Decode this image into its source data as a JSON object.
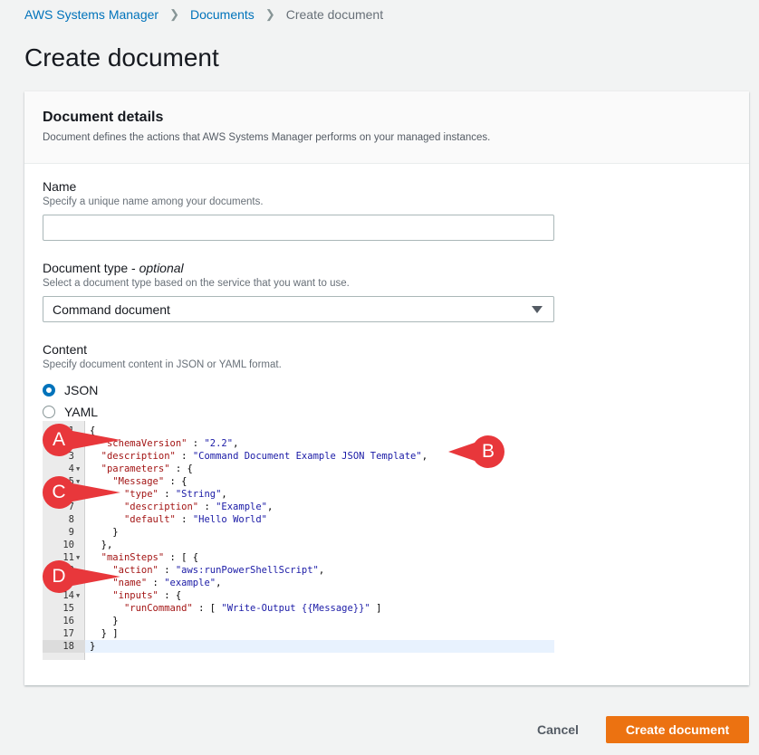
{
  "breadcrumb": {
    "root": "AWS Systems Manager",
    "parent": "Documents",
    "current": "Create document"
  },
  "page": {
    "title": "Create document"
  },
  "panel": {
    "title": "Document details",
    "description": "Document defines the actions that AWS Systems Manager performs on your managed instances."
  },
  "name_field": {
    "label": "Name",
    "description": "Specify a unique name among your documents.",
    "value": ""
  },
  "doctype_field": {
    "label": "Document type - ",
    "label_optional": "optional",
    "description": "Select a document type based on the service that you want to use.",
    "selected": "Command document"
  },
  "content_field": {
    "label": "Content",
    "description": "Specify document content in JSON or YAML format.",
    "options": [
      {
        "label": "JSON",
        "selected": true
      },
      {
        "label": "YAML",
        "selected": false
      }
    ]
  },
  "editor": {
    "line_numbers": [
      "1",
      "2",
      "3",
      "4",
      "5",
      "6",
      "7",
      "8",
      "9",
      "10",
      "11",
      "12",
      "13",
      "14",
      "15",
      "16",
      "17",
      "18"
    ],
    "lines": [
      "{",
      "  \"schemaVersion\" : \"2.2\",",
      "  \"description\" : \"Command Document Example JSON Template\",",
      "  \"parameters\" : {",
      "    \"Message\" : {",
      "      \"type\" : \"String\",",
      "      \"description\" : \"Example\",",
      "      \"default\" : \"Hello World\"",
      "    }",
      "  },",
      "  \"mainSteps\" : [ {",
      "    \"action\" : \"aws:runPowerShellScript\",",
      "    \"name\" : \"example\",",
      "    \"inputs\" : {",
      "      \"runCommand\" : [ \"Write-Output {{Message}}\" ]",
      "    }",
      "  } ]",
      "}"
    ],
    "active_line": 18
  },
  "callouts": [
    "A",
    "B",
    "C",
    "D"
  ],
  "colors": {
    "callout": "#e8373b",
    "primary": "#ec7211",
    "link": "#0073bb"
  },
  "footer": {
    "cancel_label": "Cancel",
    "create_label": "Create document"
  }
}
